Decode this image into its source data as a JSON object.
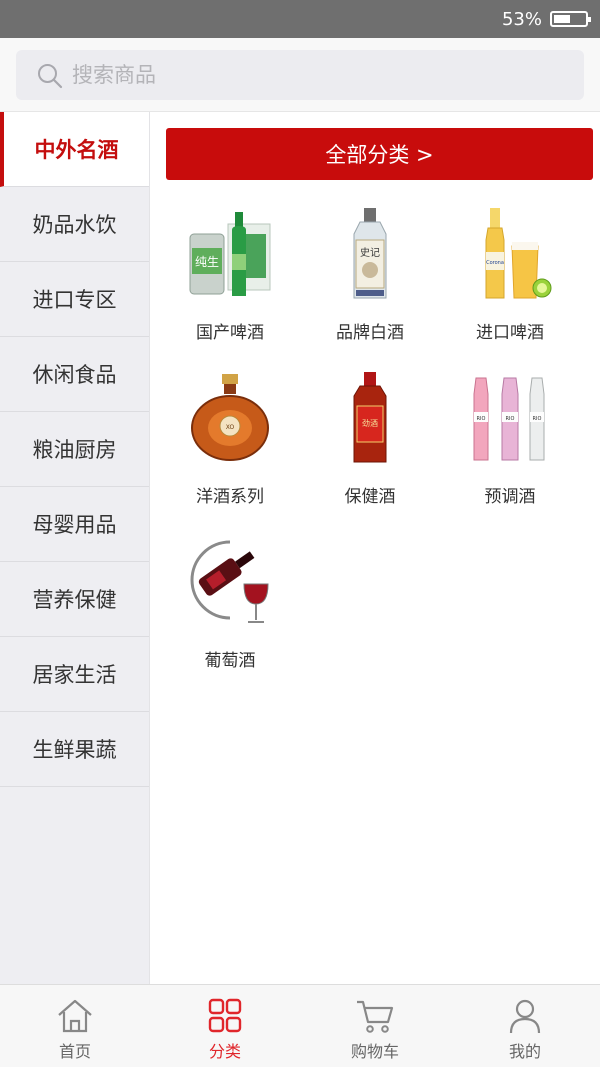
{
  "status_bar": {
    "battery_text": "53%",
    "battery_level": 0.53
  },
  "search": {
    "placeholder": "搜索商品"
  },
  "sidebar": {
    "items": [
      {
        "label": "中外名酒",
        "active": true
      },
      {
        "label": "奶品水饮"
      },
      {
        "label": "进口专区"
      },
      {
        "label": "休闲食品"
      },
      {
        "label": "粮油厨房"
      },
      {
        "label": "母婴用品"
      },
      {
        "label": "营养保健"
      },
      {
        "label": "居家生活"
      },
      {
        "label": "生鲜果蔬"
      }
    ]
  },
  "main": {
    "all_button_label": "全部分类 >",
    "products": [
      {
        "label": "国产啤酒",
        "icon": "domestic-beer-image"
      },
      {
        "label": "品牌白酒",
        "icon": "baijiu-image"
      },
      {
        "label": "进口啤酒",
        "icon": "imported-beer-image"
      },
      {
        "label": "洋酒系列",
        "icon": "cognac-image"
      },
      {
        "label": "保健酒",
        "icon": "health-wine-image"
      },
      {
        "label": "预调酒",
        "icon": "premixed-cocktail-image"
      },
      {
        "label": "葡萄酒",
        "icon": "red-wine-image"
      }
    ]
  },
  "tabbar": {
    "tabs": [
      {
        "label": "首页",
        "icon": "home-icon"
      },
      {
        "label": "分类",
        "icon": "category-icon",
        "active": true
      },
      {
        "label": "购物车",
        "icon": "cart-icon"
      },
      {
        "label": "我的",
        "icon": "user-icon"
      }
    ]
  },
  "colors": {
    "accent": "#c80c0c",
    "status_bar": "#6f6f6f",
    "sidebar_bg": "#eeeef2",
    "tab_active": "#e0262b"
  }
}
